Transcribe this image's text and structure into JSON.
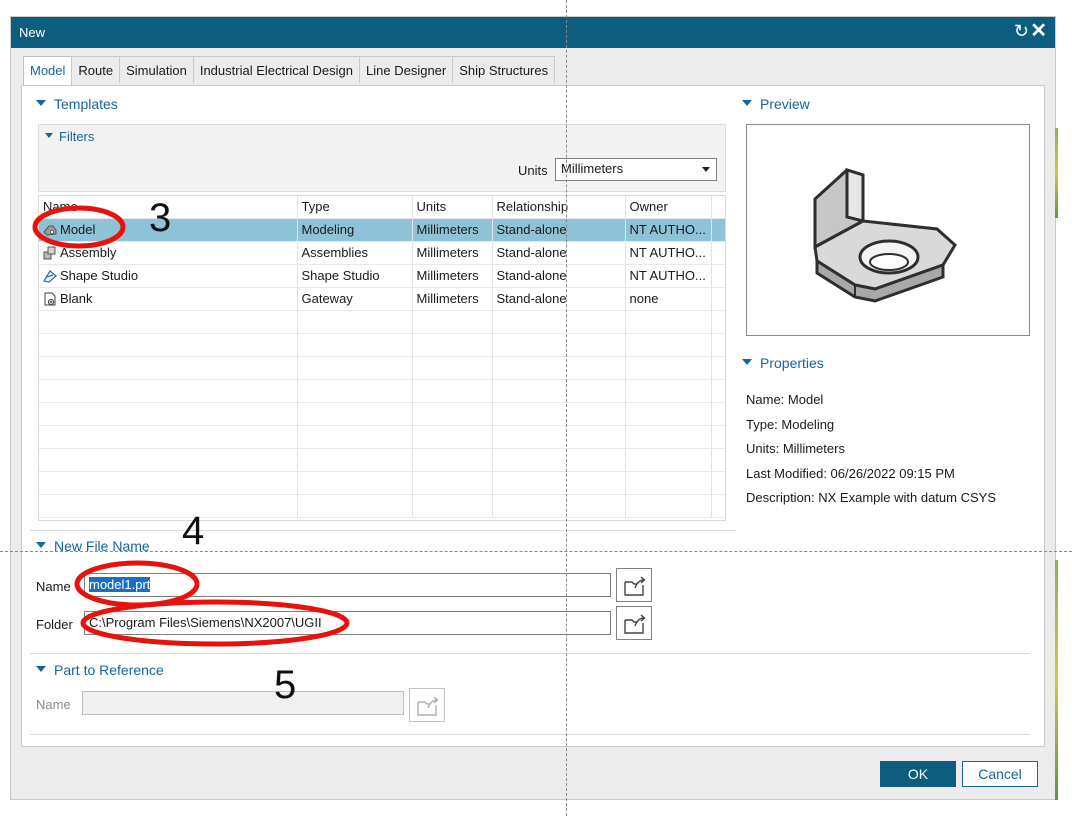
{
  "window": {
    "title": "New"
  },
  "tabs": [
    "Model",
    "Route",
    "Simulation",
    "Industrial Electrical Design",
    "Line Designer",
    "Ship Structures"
  ],
  "templates": {
    "heading": "Templates",
    "filters_heading": "Filters",
    "units_label": "Units",
    "units_value": "Millimeters",
    "columns": [
      "Name",
      "Type",
      "Units",
      "Relationship",
      "Owner"
    ],
    "rows": [
      {
        "icon": "model-part-icon",
        "name": "Model",
        "type": "Modeling",
        "units": "Millimeters",
        "relationship": "Stand-alone",
        "owner": "NT AUTHO...",
        "selected": true
      },
      {
        "icon": "assembly-icon",
        "name": "Assembly",
        "type": "Assemblies",
        "units": "Millimeters",
        "relationship": "Stand-alone",
        "owner": "NT AUTHO...",
        "selected": false
      },
      {
        "icon": "shape-studio-icon",
        "name": "Shape Studio",
        "type": "Shape Studio",
        "units": "Millimeters",
        "relationship": "Stand-alone",
        "owner": "NT AUTHO...",
        "selected": false
      },
      {
        "icon": "blank-file-icon",
        "name": "Blank",
        "type": "Gateway",
        "units": "Millimeters",
        "relationship": "Stand-alone",
        "owner": "none",
        "selected": false
      }
    ]
  },
  "preview": {
    "heading": "Preview"
  },
  "properties": {
    "heading": "Properties",
    "lines": [
      "Name: Model",
      "Type: Modeling",
      "Units: Millimeters",
      "Last Modified: 06/26/2022 09:15 PM",
      "Description: NX Example with datum CSYS"
    ]
  },
  "new_file": {
    "heading": "New File Name",
    "name_label": "Name",
    "name_value": "model1.prt",
    "folder_label": "Folder",
    "folder_value": "C:\\Program Files\\Siemens\\NX2007\\UGII"
  },
  "part_reference": {
    "heading": "Part to Reference",
    "name_label": "Name",
    "name_value": ""
  },
  "buttons": {
    "ok": "OK",
    "cancel": "Cancel"
  },
  "annotations": {
    "step3": "3",
    "step4": "4",
    "step5": "5",
    "color": "#e8120c"
  },
  "colors": {
    "titlebar": "#0d5d7e",
    "accent": "#1565a0",
    "selection": "#8ec3d7"
  }
}
